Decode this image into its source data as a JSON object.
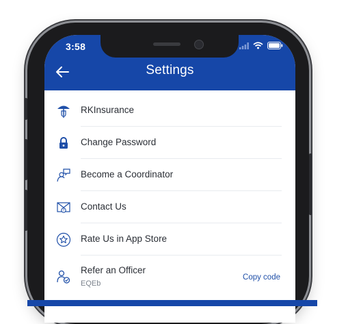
{
  "status": {
    "time": "3:58"
  },
  "header": {
    "title": "Settings"
  },
  "items": [
    {
      "label": "RKInsurance",
      "icon": "umbrella-icon"
    },
    {
      "label": "Change Password",
      "icon": "lock-icon"
    },
    {
      "label": "Become a Coordinator",
      "icon": "coordinator-icon"
    },
    {
      "label": "Contact Us",
      "icon": "envelope-icon"
    },
    {
      "label": "Rate Us in App Store",
      "icon": "star-icon"
    },
    {
      "label": "Refer an Officer",
      "sub": "EQEb",
      "icon": "refer-officer-icon",
      "action": "Copy code"
    }
  ],
  "colors": {
    "header": "#1647a8",
    "icon": "#1f4fa8",
    "text": "#2a2e35"
  }
}
